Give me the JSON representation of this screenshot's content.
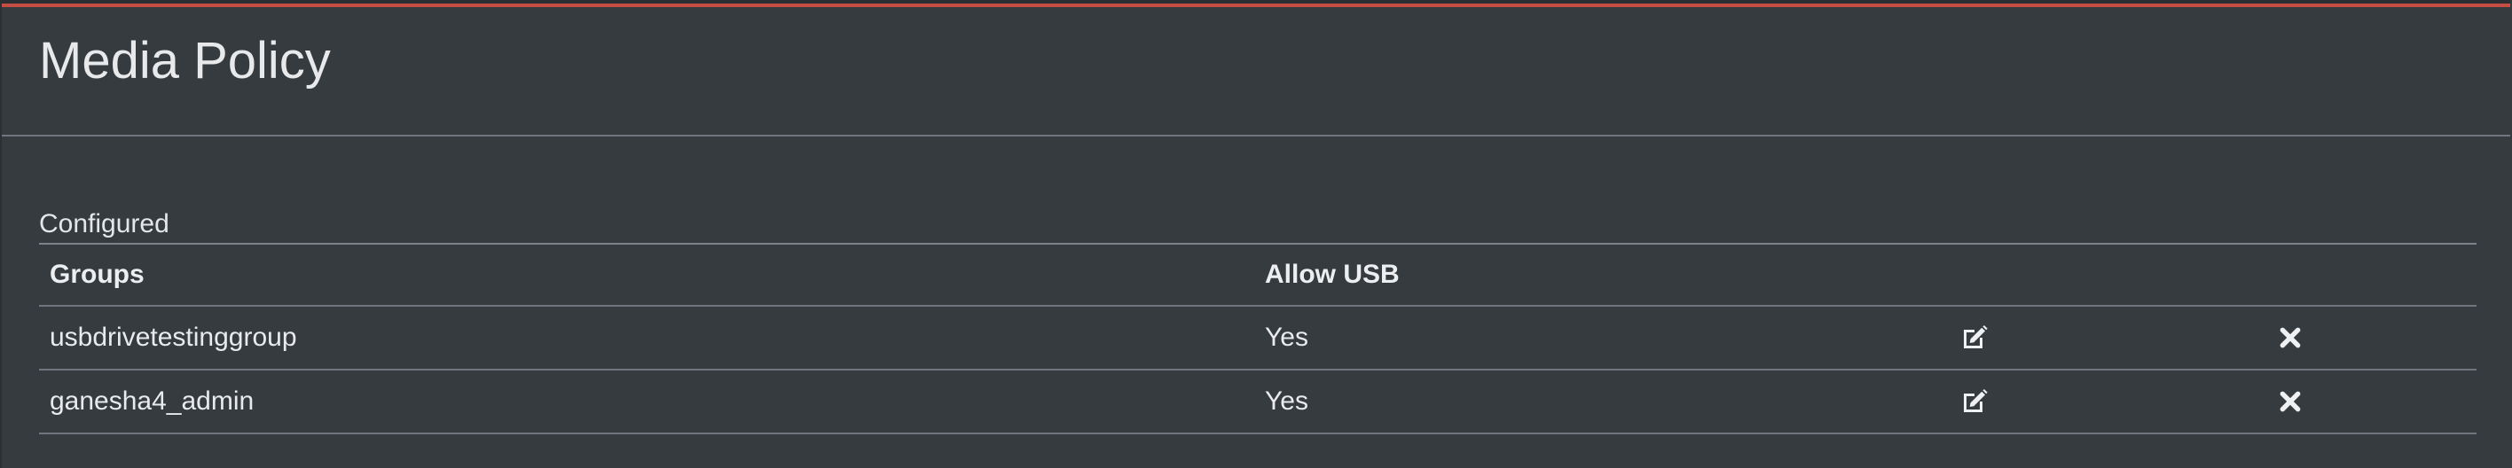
{
  "page": {
    "title": "Media Policy",
    "accent_color": "#c64d44",
    "background_color": "#363b40"
  },
  "configured": {
    "section_label": "Configured",
    "columns": {
      "groups": "Groups",
      "allow_usb": "Allow USB"
    },
    "rows": [
      {
        "group": "usbdrivetestinggroup",
        "allow_usb": "Yes",
        "edit_icon": "edit-icon",
        "delete_icon": "close-icon"
      },
      {
        "group": "ganesha4_admin",
        "allow_usb": "Yes",
        "edit_icon": "edit-icon",
        "delete_icon": "close-icon"
      }
    ]
  }
}
